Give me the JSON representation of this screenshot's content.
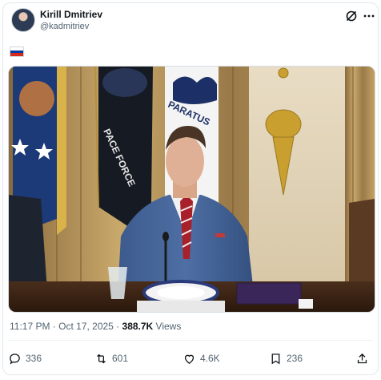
{
  "tweet": {
    "author_name": "Kirill Dmitriev",
    "author_handle": "@kadmitriev",
    "flag": "russia-flag",
    "timestamp": "11:17 PM · Oct 17, 2025 · ",
    "views_count": "388.7K",
    "views_label": " Views",
    "image_text": {
      "flag_left_text": "",
      "flag_center_text": "PACE FORCE",
      "flag_right_text": "PARATUS"
    }
  },
  "actions": {
    "reply_count": "336",
    "retweet_count": "601",
    "like_count": "4.6K",
    "bookmark_count": "236"
  },
  "icons": [
    "grok-icon",
    "more-icon",
    "reply-icon",
    "retweet-icon",
    "like-icon",
    "bookmark-icon",
    "share-icon"
  ],
  "colors": {
    "text_primary": "#0f1419",
    "text_secondary": "#536471",
    "flag_white": "#ffffff",
    "flag_blue": "#0039a6",
    "flag_red": "#d52b1e"
  }
}
